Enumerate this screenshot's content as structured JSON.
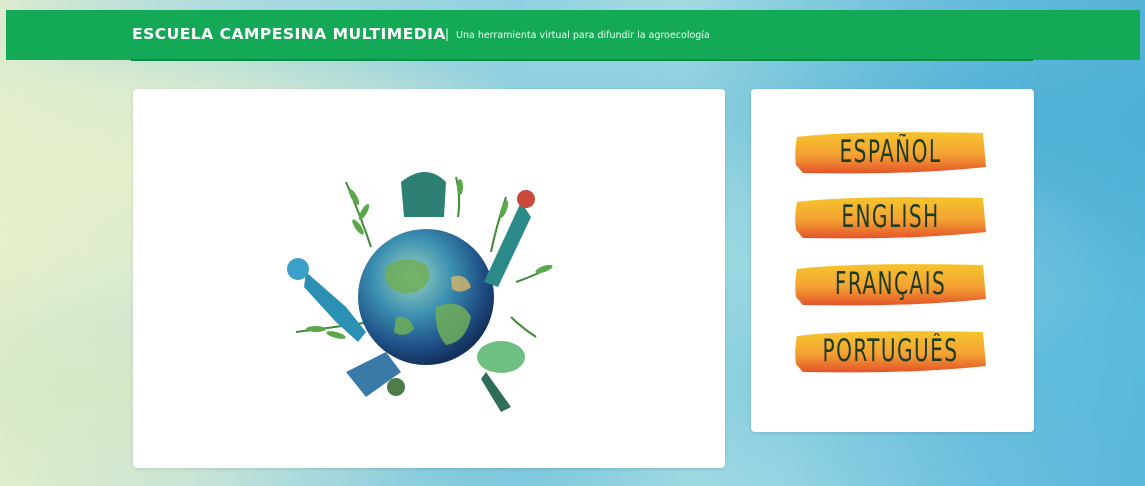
{
  "header": {
    "title": "ESCUELA CAMPESINA MULTIMEDIA",
    "separator": "|",
    "tagline": "Una herramienta virtual para difundir la agroecología",
    "bar_color": "#13a957"
  },
  "hero": {
    "image": "globe-with-farmers-illustration"
  },
  "languages": [
    {
      "label": "ESPAÑOL"
    },
    {
      "label": "ENGLISH"
    },
    {
      "label": "FRANÇAIS"
    },
    {
      "label": "PORTUGUÊS"
    }
  ],
  "colors": {
    "button_top": "#f6c42c",
    "button_bottom": "#e4532a",
    "button_text": "#1f3b1f"
  }
}
